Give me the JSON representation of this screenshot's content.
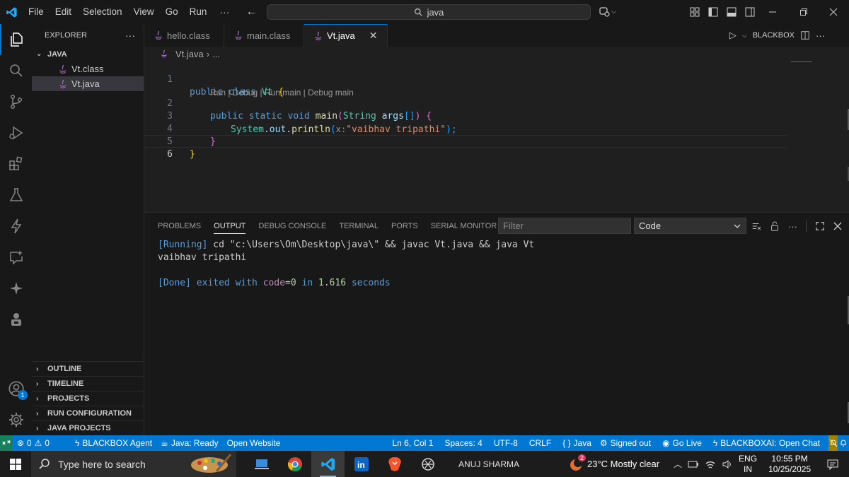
{
  "titlebar": {
    "menu": [
      "File",
      "Edit",
      "Selection",
      "View",
      "Go",
      "Run",
      "···"
    ],
    "search_text": "java"
  },
  "explorer": {
    "header": "EXPLORER",
    "folder": "JAVA",
    "files": [
      "Vt.class",
      "Vt.java"
    ],
    "sections": [
      "OUTLINE",
      "TIMELINE",
      "PROJECTS",
      "RUN CONFIGURATION",
      "JAVA PROJECTS"
    ]
  },
  "activity": {
    "accounts_badge": "1"
  },
  "editor": {
    "tabs": [
      "hello.class",
      "main.class",
      "Vt.java"
    ],
    "active_tab": "Vt.java",
    "actions_label": "BLACKBOX",
    "breadcrumb": [
      "Vt.java",
      "›",
      "..."
    ],
    "line_numbers": [
      "1",
      "2",
      "3",
      "4",
      "5",
      "6"
    ],
    "codelens": "Run | Debug | Run main | Debug main",
    "code": {
      "l1_kw": "public class ",
      "l1_name": "Vt",
      "l1_brace": "{",
      "l2_kw": "public static void ",
      "l2_fn": "main",
      "l2_paren": "(",
      "l2_type": "String ",
      "l2_arg": "args",
      "l2_arr": "[]",
      "l2_close": ")",
      "l2_brace": "{",
      "l3_sys": "System",
      "l3_dot": ".",
      "l3_out": "out",
      "l3_dot2": ".",
      "l3_fn": "println",
      "l3_open": "(",
      "l3_hint": "x:",
      "l3_str": "\"vaibhav tripathi\"",
      "l3_close": ");",
      "l4_brace": "}",
      "l5_brace": "}"
    }
  },
  "panel": {
    "tabs": [
      "PROBLEMS",
      "OUTPUT",
      "DEBUG CONSOLE",
      "TERMINAL",
      "PORTS",
      "SERIAL MONITOR"
    ],
    "active_tab": "OUTPUT",
    "filter_placeholder": "Filter",
    "channel": "Code",
    "output": {
      "running_tag": "[Running]",
      "running_cmd": " cd \"c:\\Users\\Om\\Desktop\\java\\\" && javac Vt.java && java Vt",
      "program_output": "vaibhav tripathi",
      "done_tag": "[Done]",
      "done_text1": " exited with ",
      "done_code_kw": "code",
      "done_eq": "=",
      "done_code": "0",
      "done_in": " in ",
      "done_time": "1.616",
      "done_seconds": " seconds"
    }
  },
  "statusbar": {
    "errors": "0",
    "warnings": "0",
    "blackbox_agent": "BLACKBOX Agent",
    "java_status": "Java: Ready",
    "open_website": "Open Website",
    "cursor": "Ln 6, Col 1",
    "spaces": "Spaces: 4",
    "encoding": "UTF-8",
    "eol": "CRLF",
    "language": "Java",
    "signed_out": "Signed out",
    "go_live": "Go Live",
    "blackbox_chat": "BLACKBOXAI: Open Chat"
  },
  "taskbar": {
    "search_placeholder": "Type here to search",
    "user": "ANUJ SHARMA",
    "weather_badge": "2",
    "weather": "23°C  Mostly clear",
    "lang_line1": "ENG",
    "lang_line2": "IN",
    "time": "10:55 PM",
    "date": "10/25/2025"
  },
  "colors": {
    "accent": "#0078d4",
    "remote": "#16825d",
    "editor_bg": "#1f1f1f",
    "sidebar_bg": "#181818"
  }
}
